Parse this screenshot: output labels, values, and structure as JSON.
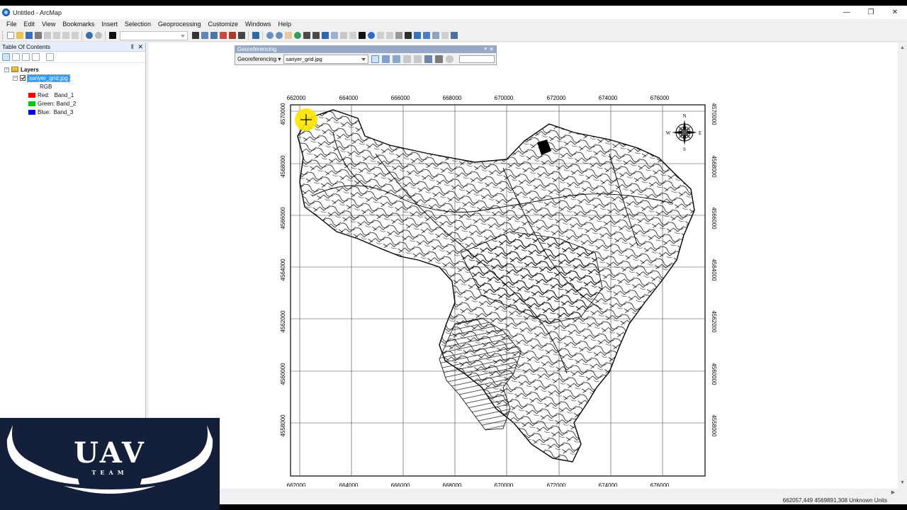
{
  "window": {
    "title": "Untitled - ArcMap",
    "controls": [
      "—",
      "❐",
      "✕"
    ]
  },
  "menu": [
    "File",
    "Edit",
    "View",
    "Bookmarks",
    "Insert",
    "Selection",
    "Geoprocessing",
    "Customize",
    "Windows",
    "Help"
  ],
  "toc": {
    "title": "Table Of Contents",
    "pin_glyph": "‖",
    "close_glyph": "✕",
    "root": "Layers",
    "layer": "sariyer_grid.jpg",
    "render_label": "RGB",
    "bands": [
      {
        "label": "Red:   Band_1",
        "color": "#ff0000"
      },
      {
        "label": "Green: Band_2",
        "color": "#00cc00"
      },
      {
        "label": "Blue:  Band_3",
        "color": "#0000ff"
      }
    ]
  },
  "georef": {
    "title": "Georeferencing",
    "menu_label": "Georeferencing ▾",
    "layer_select": "sariyer_grid.jpg",
    "pin_glyph": "▾",
    "close_glyph": "✕"
  },
  "map": {
    "x_ticks": [
      "662000",
      "664000",
      "666000",
      "668000",
      "670000",
      "672000",
      "674000",
      "676000"
    ],
    "y_ticks": [
      "4570000",
      "4568000",
      "4566000",
      "4564000",
      "4562000",
      "4560000",
      "4558000"
    ],
    "bottom_ticks": [
      "662000",
      "664000",
      "666000",
      "668000",
      "670000",
      "672000",
      "674000",
      "676000"
    ],
    "compass": {
      "n": "N",
      "s": "S",
      "e": "E",
      "w": "W"
    }
  },
  "status": {
    "coords": "662057,449  4569891,308 Unknown Units"
  },
  "logo": {
    "title": "UAV",
    "subtitle": "TEAM"
  },
  "colors": {
    "selection": "#3399ff",
    "cursor_highlight": "#ffe600",
    "logo_bg": "#141f3a"
  }
}
